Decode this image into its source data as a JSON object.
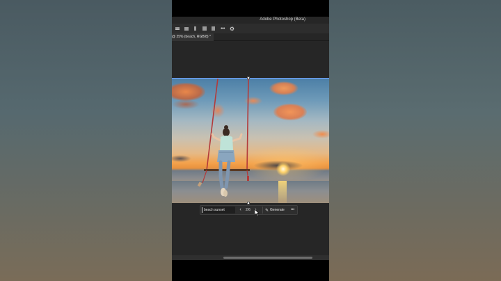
{
  "app": {
    "title": "Adobe Photoshop (Beta)"
  },
  "document": {
    "tab_label": "@ 25% (beach, RGB/8) *"
  },
  "toolbar": {
    "icons": [
      "align-left-icon",
      "align-center-icon",
      "align-top-icon",
      "align-middle-icon",
      "align-bottom-icon",
      "more-icon",
      "settings-icon"
    ],
    "more_label": "•••",
    "gear_label": "⚙"
  },
  "contextual_taskbar": {
    "prompt_value": "beach sunset",
    "prev_symbol": "‹",
    "next_symbol": "›",
    "variation_count": "2/6",
    "generate_label": "Generate",
    "more_label": "•••"
  },
  "colors": {
    "app_dark": "#262626",
    "panel": "#2e2e2e",
    "selection_blue": "#6fa4ff"
  }
}
